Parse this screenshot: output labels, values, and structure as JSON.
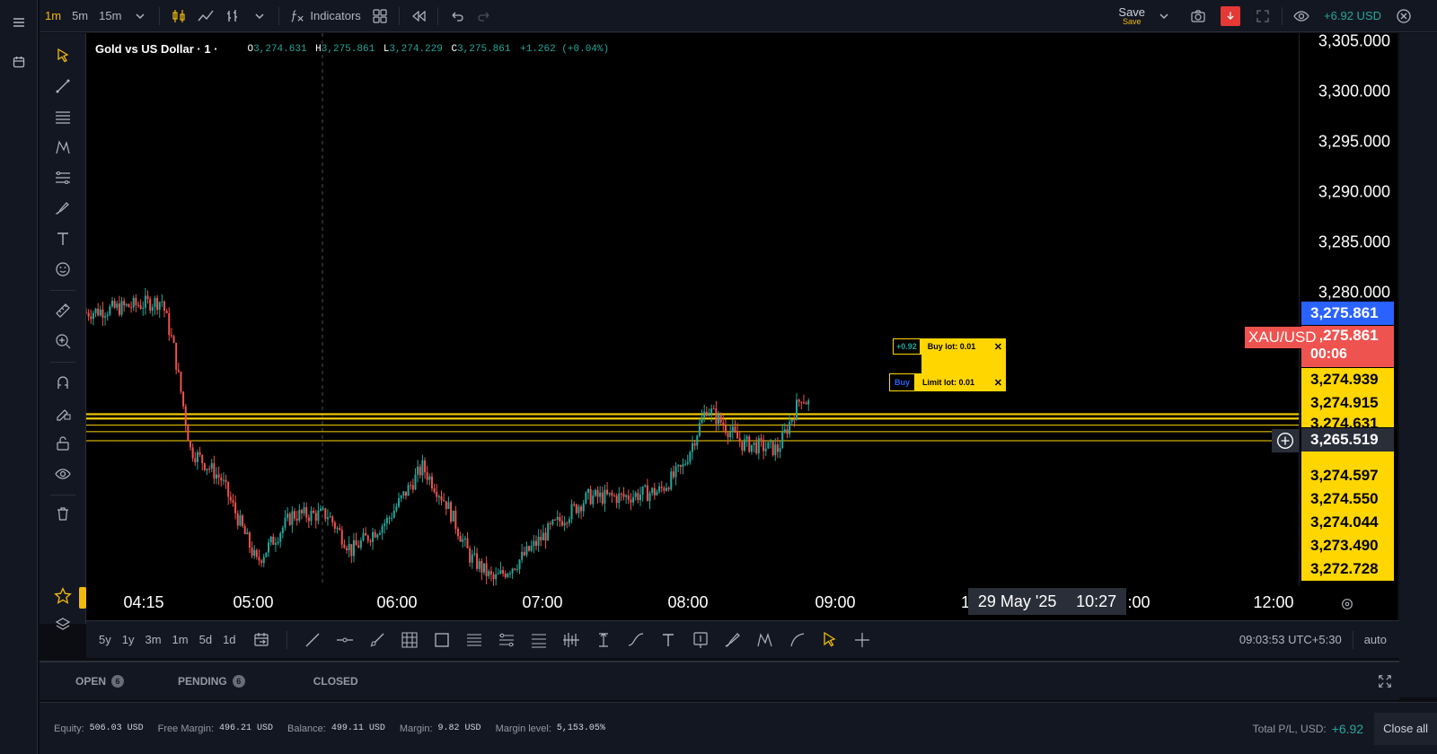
{
  "topbar": {
    "intervals": [
      "1m",
      "5m",
      "15m"
    ],
    "active_interval": "1m",
    "indicators_label": "Indicators",
    "save_label": "Save",
    "save_sub": "Save",
    "pnl": "+6.92 USD"
  },
  "chart": {
    "symbol_title": "Gold vs US Dollar · 1 ·",
    "ohlc": {
      "o_label": "O",
      "o": "3,274.631",
      "h_label": "H",
      "h": "3,275.861",
      "l_label": "L",
      "l": "3,274.229",
      "c_label": "C",
      "c": "3,275.861",
      "change": "+1.262 (+0.04%)"
    },
    "colors": {
      "up": "#26a69a",
      "down": "#ef5350",
      "order_line": "#ffd600",
      "current_price": "#2962ff"
    }
  },
  "chart_data": {
    "type": "candlestick",
    "symbol": "XAU/USD",
    "interval": "1m",
    "x_ticks": [
      "04:15",
      "05:00",
      "06:00",
      "07:00",
      "08:00",
      "09:00",
      "12:00"
    ],
    "y_ticks": [
      3305,
      3300,
      3295,
      3290,
      3285,
      3280
    ],
    "y_range": [
      3260.5,
      3307
    ],
    "x_range": [
      "03:58",
      "12:30"
    ],
    "price_path": [
      {
        "t": "03:58",
        "p": 3283.5
      },
      {
        "t": "04:15",
        "p": 3284.0
      },
      {
        "t": "04:30",
        "p": 3284.5
      },
      {
        "t": "04:35",
        "p": 3280.5
      },
      {
        "t": "04:42",
        "p": 3272.0
      },
      {
        "t": "04:55",
        "p": 3269.5
      },
      {
        "t": "05:10",
        "p": 3262.5
      },
      {
        "t": "05:25",
        "p": 3266.5
      },
      {
        "t": "05:40",
        "p": 3266.5
      },
      {
        "t": "05:50",
        "p": 3263.5
      },
      {
        "t": "06:05",
        "p": 3266.0
      },
      {
        "t": "06:20",
        "p": 3270.5
      },
      {
        "t": "06:30",
        "p": 3267.5
      },
      {
        "t": "06:40",
        "p": 3263.0
      },
      {
        "t": "06:50",
        "p": 3261.0
      },
      {
        "t": "07:00",
        "p": 3262.5
      },
      {
        "t": "07:15",
        "p": 3265.5
      },
      {
        "t": "07:30",
        "p": 3268.0
      },
      {
        "t": "07:45",
        "p": 3268.0
      },
      {
        "t": "08:00",
        "p": 3268.5
      },
      {
        "t": "08:10",
        "p": 3270.5
      },
      {
        "t": "08:20",
        "p": 3275.5
      },
      {
        "t": "08:35",
        "p": 3272.5
      },
      {
        "t": "08:50",
        "p": 3272.0
      },
      {
        "t": "09:00",
        "p": 3276.5
      },
      {
        "t": "09:03",
        "p": 3275.861
      }
    ],
    "order_levels": [
      3275.0,
      3274.939,
      3274.915,
      3274.631,
      3274.597,
      3274.55,
      3274.044,
      3273.49,
      3272.728
    ]
  },
  "price_axis": {
    "labels": [
      "3,305.000",
      "3,300.000",
      "3,295.000",
      "3,290.000",
      "3,285.000",
      "3,280.000"
    ],
    "current_blue": "3,275.861",
    "symbol_tag": "XAU/USD",
    "current_red": "3,275.861",
    "countdown": "00:06",
    "yellow_tags": [
      "3,274.939",
      "3,274.915",
      "3,274.631",
      "3,274.597",
      "3,274.550",
      "3,274.044",
      "3,273.490",
      "3,272.728"
    ],
    "crosshair_price": "3,265.519"
  },
  "orders_on_chart": {
    "buy_pnl": "+0.92",
    "buy_label": "Buy lot: 0.01",
    "limit_side": "Buy",
    "limit_label": "Limit lot: 0.01",
    "close_glyph": "✕"
  },
  "time_axis": {
    "labels": [
      "04:15",
      "05:00",
      "06:00",
      "07:00",
      "08:00",
      "09:00",
      "12:00"
    ],
    "crosshair_date": "29 May '25",
    "crosshair_time": "10:27",
    "partial_left": "1",
    "partial_right": ":00"
  },
  "bottom_toolbar": {
    "ranges": [
      "5y",
      "1y",
      "3m",
      "1m",
      "5d",
      "1d"
    ],
    "clock": "09:03:53 UTC+5:30",
    "auto_label": "auto"
  },
  "orders_panel": {
    "tabs": [
      {
        "label": "OPEN",
        "count": "6"
      },
      {
        "label": "PENDING",
        "count": "6"
      },
      {
        "label": "CLOSED",
        "count": null
      }
    ]
  },
  "status": {
    "equity_label": "Equity:",
    "equity": "506.03 USD",
    "free_margin_label": "Free Margin:",
    "free_margin": "496.21 USD",
    "balance_label": "Balance:",
    "balance": "499.11 USD",
    "margin_label": "Margin:",
    "margin": "9.82 USD",
    "margin_level_label": "Margin level:",
    "margin_level": "5,153.05%",
    "total_pl_label": "Total P/L, USD:",
    "total_pl": "+6.92",
    "close_all_label": "Close all"
  }
}
